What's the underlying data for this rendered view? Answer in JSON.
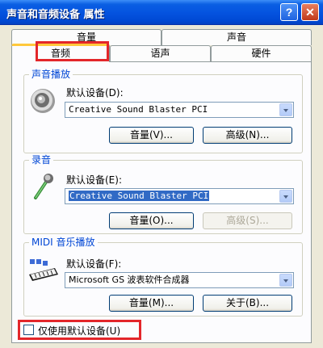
{
  "window": {
    "title": "声音和音频设备 属性",
    "help_label": "?",
    "close_label": "✕"
  },
  "tabs": {
    "row1": [
      "音量",
      "声音"
    ],
    "row2": [
      "音频",
      "语声",
      "硬件"
    ],
    "active": "音频"
  },
  "playback": {
    "title": "声音播放",
    "default_device_label": "默认设备(D):",
    "device": "Creative Sound Blaster PCI",
    "volume_button": "音量(V)...",
    "advanced_button": "高级(N)...",
    "icon": "speaker-icon"
  },
  "recording": {
    "title": "录音",
    "default_device_label": "默认设备(E):",
    "device": "Creative Sound Blaster PCI",
    "volume_button": "音量(O)...",
    "advanced_button": "高级(S)...",
    "icon": "microphone-icon"
  },
  "midi": {
    "title": "MIDI 音乐播放",
    "default_device_label": "默认设备(F):",
    "device": "Microsoft GS 波表软件合成器",
    "volume_button": "音量(M)...",
    "about_button": "关于(B)...",
    "icon": "midi-keyboard-icon"
  },
  "options": {
    "use_default_only_label": "仅使用默认设备(U)",
    "use_default_only_checked": false
  },
  "colors": {
    "titlebar": "#0554e0",
    "group_title": "#0046d5",
    "highlight_box": "#e3262a",
    "selection": "#316ac5"
  }
}
